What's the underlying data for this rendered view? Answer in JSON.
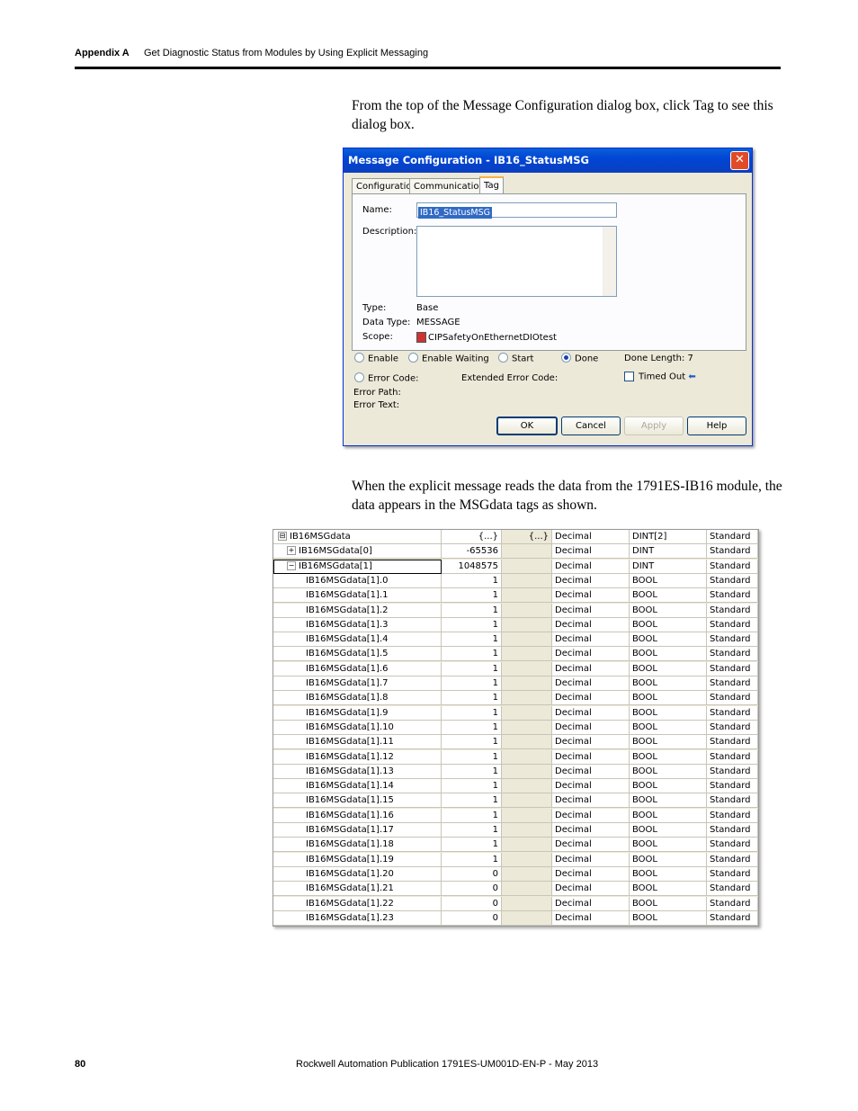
{
  "header": {
    "appendix": "Appendix A",
    "title": "Get Diagnostic Status from Modules by Using Explicit Messaging"
  },
  "intro_text": "From the top of the Message Configuration dialog box, click Tag to see this dialog box.",
  "dialog": {
    "title": "Message Configuration - IB16_StatusMSG",
    "close_glyph": "✕",
    "tabs": [
      "Configuration",
      "Communication",
      "Tag"
    ],
    "name_label": "Name:",
    "name_value": "IB16_StatusMSG",
    "description_label": "Description:",
    "type_label": "Type:",
    "type_value": "Base",
    "data_type_label": "Data Type:",
    "data_type_value": "MESSAGE",
    "scope_label": "Scope:",
    "scope_value": "CIPSafetyOnEthernetDIOtest",
    "status": {
      "enable": "Enable",
      "enable_waiting": "Enable Waiting",
      "start": "Start",
      "done": "Done",
      "done_length": "Done Length:  7",
      "error_code": "Error Code:",
      "extended_error_code": "Extended Error Code:",
      "timed_out": "Timed Out",
      "timed_out_arrow": "⬅",
      "error_path": "Error Path:",
      "error_text": "Error Text:"
    },
    "buttons": {
      "ok": "OK",
      "cancel": "Cancel",
      "apply": "Apply",
      "help": "Help"
    }
  },
  "second_text": "When the explicit message reads the data from the 1791ES-IB16 module, the data appears in the MSGdata tags as shown.",
  "tag_grid": {
    "rows": [
      {
        "name": "IB16MSGdata",
        "expander": "⊟",
        "level": 0,
        "value": "{...}",
        "force": "{...}",
        "style": "Decimal",
        "type": "DINT[2]",
        "class": "Standard"
      },
      {
        "name": "IB16MSGdata[0]",
        "expander": "+",
        "level": 1,
        "value": "-65536",
        "force": "",
        "style": "Decimal",
        "type": "DINT",
        "class": "Standard"
      },
      {
        "name": "IB16MSGdata[1]",
        "expander": "−",
        "level": 1,
        "value": "1048575",
        "force": "",
        "style": "Decimal",
        "type": "DINT",
        "class": "Standard"
      },
      {
        "name": "IB16MSGdata[1].0",
        "level": 2,
        "value": "1",
        "force": "",
        "style": "Decimal",
        "type": "BOOL",
        "class": "Standard"
      },
      {
        "name": "IB16MSGdata[1].1",
        "level": 2,
        "value": "1",
        "force": "",
        "style": "Decimal",
        "type": "BOOL",
        "class": "Standard"
      },
      {
        "name": "IB16MSGdata[1].2",
        "level": 2,
        "value": "1",
        "force": "",
        "style": "Decimal",
        "type": "BOOL",
        "class": "Standard"
      },
      {
        "name": "IB16MSGdata[1].3",
        "level": 2,
        "value": "1",
        "force": "",
        "style": "Decimal",
        "type": "BOOL",
        "class": "Standard"
      },
      {
        "name": "IB16MSGdata[1].4",
        "level": 2,
        "value": "1",
        "force": "",
        "style": "Decimal",
        "type": "BOOL",
        "class": "Standard"
      },
      {
        "name": "IB16MSGdata[1].5",
        "level": 2,
        "value": "1",
        "force": "",
        "style": "Decimal",
        "type": "BOOL",
        "class": "Standard"
      },
      {
        "name": "IB16MSGdata[1].6",
        "level": 2,
        "value": "1",
        "force": "",
        "style": "Decimal",
        "type": "BOOL",
        "class": "Standard"
      },
      {
        "name": "IB16MSGdata[1].7",
        "level": 2,
        "value": "1",
        "force": "",
        "style": "Decimal",
        "type": "BOOL",
        "class": "Standard"
      },
      {
        "name": "IB16MSGdata[1].8",
        "level": 2,
        "value": "1",
        "force": "",
        "style": "Decimal",
        "type": "BOOL",
        "class": "Standard"
      },
      {
        "name": "IB16MSGdata[1].9",
        "level": 2,
        "value": "1",
        "force": "",
        "style": "Decimal",
        "type": "BOOL",
        "class": "Standard"
      },
      {
        "name": "IB16MSGdata[1].10",
        "level": 2,
        "value": "1",
        "force": "",
        "style": "Decimal",
        "type": "BOOL",
        "class": "Standard"
      },
      {
        "name": "IB16MSGdata[1].11",
        "level": 2,
        "value": "1",
        "force": "",
        "style": "Decimal",
        "type": "BOOL",
        "class": "Standard"
      },
      {
        "name": "IB16MSGdata[1].12",
        "level": 2,
        "value": "1",
        "force": "",
        "style": "Decimal",
        "type": "BOOL",
        "class": "Standard"
      },
      {
        "name": "IB16MSGdata[1].13",
        "level": 2,
        "value": "1",
        "force": "",
        "style": "Decimal",
        "type": "BOOL",
        "class": "Standard"
      },
      {
        "name": "IB16MSGdata[1].14",
        "level": 2,
        "value": "1",
        "force": "",
        "style": "Decimal",
        "type": "BOOL",
        "class": "Standard"
      },
      {
        "name": "IB16MSGdata[1].15",
        "level": 2,
        "value": "1",
        "force": "",
        "style": "Decimal",
        "type": "BOOL",
        "class": "Standard"
      },
      {
        "name": "IB16MSGdata[1].16",
        "level": 2,
        "value": "1",
        "force": "",
        "style": "Decimal",
        "type": "BOOL",
        "class": "Standard"
      },
      {
        "name": "IB16MSGdata[1].17",
        "level": 2,
        "value": "1",
        "force": "",
        "style": "Decimal",
        "type": "BOOL",
        "class": "Standard"
      },
      {
        "name": "IB16MSGdata[1].18",
        "level": 2,
        "value": "1",
        "force": "",
        "style": "Decimal",
        "type": "BOOL",
        "class": "Standard"
      },
      {
        "name": "IB16MSGdata[1].19",
        "level": 2,
        "value": "1",
        "force": "",
        "style": "Decimal",
        "type": "BOOL",
        "class": "Standard"
      },
      {
        "name": "IB16MSGdata[1].20",
        "level": 2,
        "value": "0",
        "force": "",
        "style": "Decimal",
        "type": "BOOL",
        "class": "Standard"
      },
      {
        "name": "IB16MSGdata[1].21",
        "level": 2,
        "value": "0",
        "force": "",
        "style": "Decimal",
        "type": "BOOL",
        "class": "Standard"
      },
      {
        "name": "IB16MSGdata[1].22",
        "level": 2,
        "value": "0",
        "force": "",
        "style": "Decimal",
        "type": "BOOL",
        "class": "Standard"
      },
      {
        "name": "IB16MSGdata[1].23",
        "level": 2,
        "value": "0",
        "force": "",
        "style": "Decimal",
        "type": "BOOL",
        "class": "Standard"
      }
    ]
  },
  "footer": {
    "page": "80",
    "publication": "Rockwell Automation Publication 1791ES-UM001D-EN-P - May 2013"
  }
}
